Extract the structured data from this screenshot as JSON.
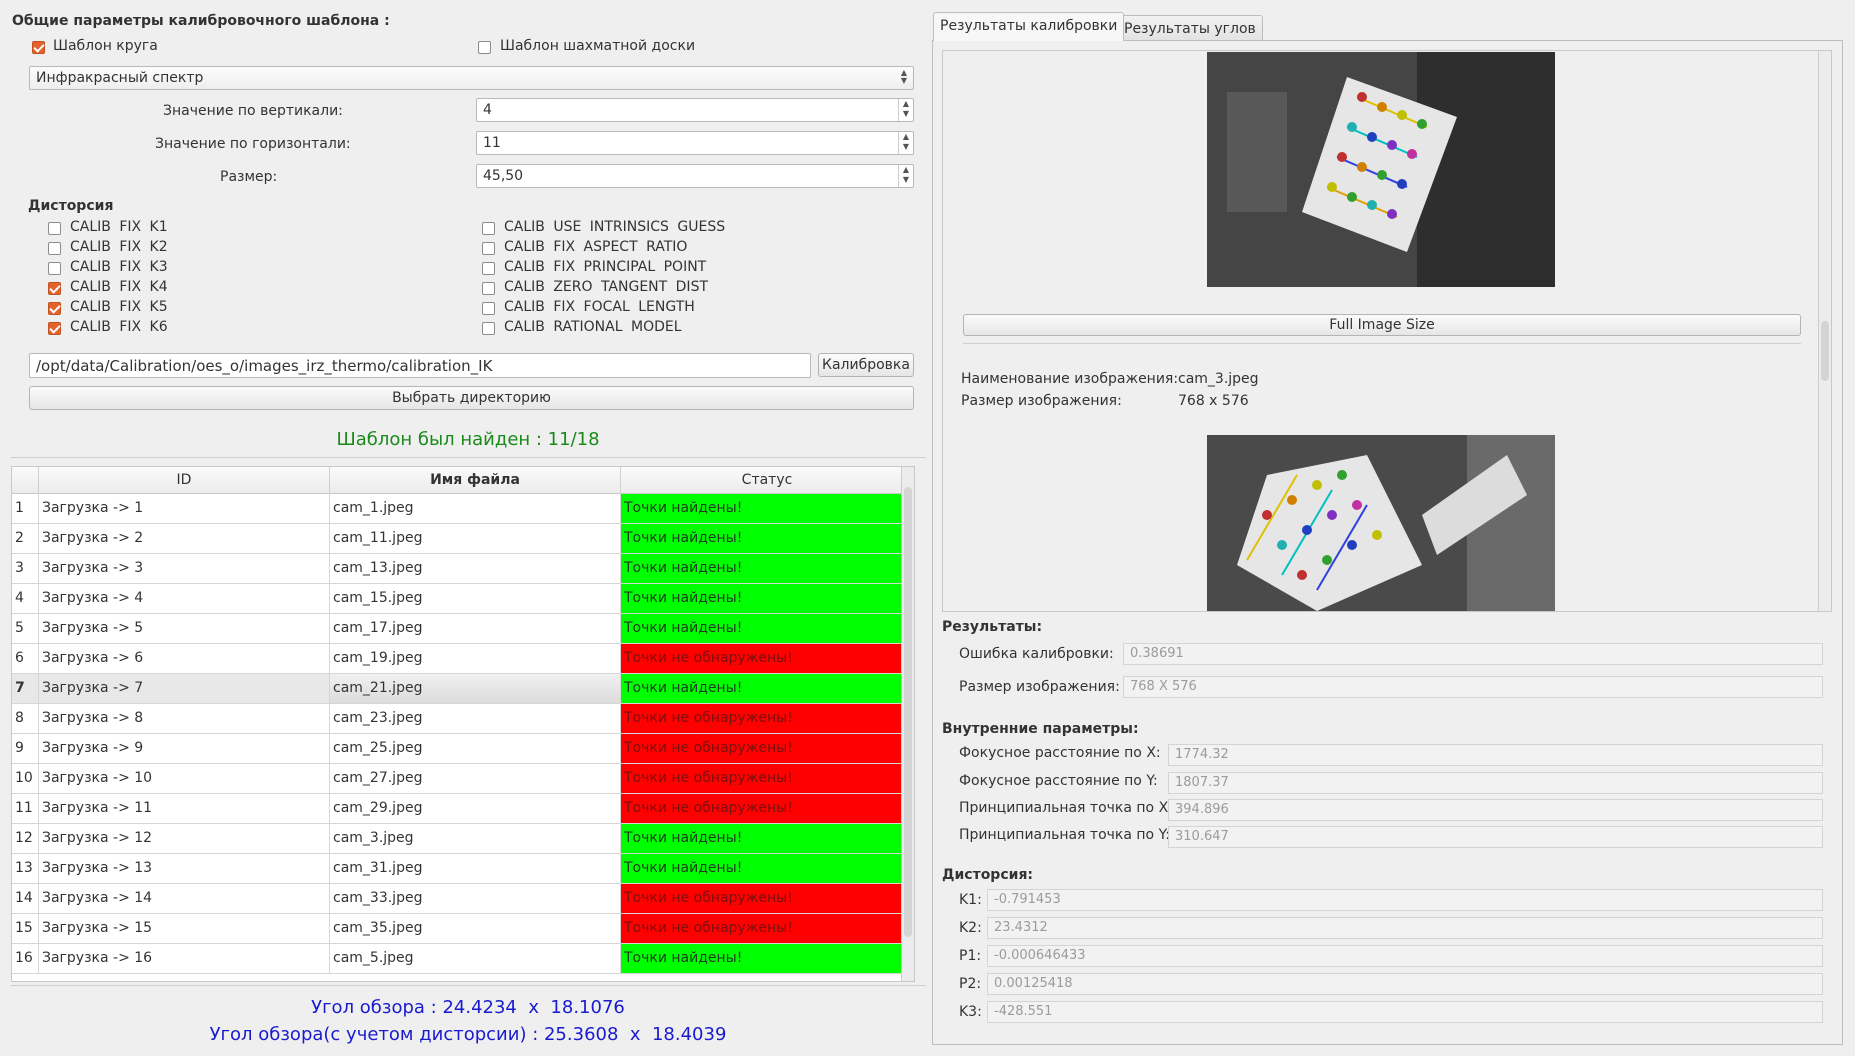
{
  "left": {
    "section_title": "Общие параметры калибровочного шаблона :",
    "circle_template": {
      "label": "Шаблон круга",
      "checked": true
    },
    "chess_template": {
      "label": "Шаблон шахматной доски",
      "checked": false
    },
    "spectrum_select": "Инфракрасный спектр",
    "vertical": {
      "label": "Значение по вертикали:",
      "value": "4"
    },
    "horizontal": {
      "label": "Значение по горизонтали:",
      "value": "11"
    },
    "size": {
      "label": "Размер:",
      "value": "45,50"
    },
    "distortion_title": "Дисторсия",
    "flags_left": [
      {
        "label": "CALIB FIX K1",
        "checked": false
      },
      {
        "label": "CALIB FIX K2",
        "checked": false
      },
      {
        "label": "CALIB FIX K3",
        "checked": false
      },
      {
        "label": "CALIB FIX K4",
        "checked": true
      },
      {
        "label": "CALIB FIX K5",
        "checked": true
      },
      {
        "label": "CALIB FIX K6",
        "checked": true
      }
    ],
    "flags_right": [
      {
        "label": "CALIB USE INTRINSICS GUESS",
        "checked": false
      },
      {
        "label": "CALIB FIX ASPECT RATIO",
        "checked": false
      },
      {
        "label": "CALIB FIX PRINCIPAL POINT",
        "checked": false
      },
      {
        "label": "CALIB ZERO TANGENT DIST",
        "checked": false
      },
      {
        "label": "CALIB FIX FOCAL LENGTH",
        "checked": false
      },
      {
        "label": "CALIB RATIONAL MODEL",
        "checked": false
      }
    ],
    "path_value": "/opt/data/Calibration/oes_o/images_irz_thermo/calibration_IK",
    "calibrate_button": "Калибровка",
    "choose_dir_button": "Выбрать директорию",
    "found_text": "Шаблон был найден : 11/18",
    "table": {
      "headers": [
        "ID",
        "Имя файла",
        "Статус"
      ],
      "rows": [
        {
          "n": "1",
          "id": "Загрузка -> 1",
          "file": "cam_1.jpeg",
          "status": "Точки найдены!",
          "ok": true
        },
        {
          "n": "2",
          "id": "Загрузка -> 2",
          "file": "cam_11.jpeg",
          "status": "Точки найдены!",
          "ok": true
        },
        {
          "n": "3",
          "id": "Загрузка -> 3",
          "file": "cam_13.jpeg",
          "status": "Точки найдены!",
          "ok": true
        },
        {
          "n": "4",
          "id": "Загрузка -> 4",
          "file": "cam_15.jpeg",
          "status": "Точки найдены!",
          "ok": true
        },
        {
          "n": "5",
          "id": "Загрузка -> 5",
          "file": "cam_17.jpeg",
          "status": "Точки найдены!",
          "ok": true
        },
        {
          "n": "6",
          "id": "Загрузка -> 6",
          "file": "cam_19.jpeg",
          "status": "Точки не обнаружены!",
          "ok": false
        },
        {
          "n": "7",
          "id": "Загрузка -> 7",
          "file": "cam_21.jpeg",
          "status": "Точки найдены!",
          "ok": true,
          "selected": true
        },
        {
          "n": "8",
          "id": "Загрузка -> 8",
          "file": "cam_23.jpeg",
          "status": "Точки не обнаружены!",
          "ok": false
        },
        {
          "n": "9",
          "id": "Загрузка -> 9",
          "file": "cam_25.jpeg",
          "status": "Точки не обнаружены!",
          "ok": false
        },
        {
          "n": "10",
          "id": "Загрузка -> 10",
          "file": "cam_27.jpeg",
          "status": "Точки не обнаружены!",
          "ok": false
        },
        {
          "n": "11",
          "id": "Загрузка -> 11",
          "file": "cam_29.jpeg",
          "status": "Точки не обнаружены!",
          "ok": false
        },
        {
          "n": "12",
          "id": "Загрузка -> 12",
          "file": "cam_3.jpeg",
          "status": "Точки найдены!",
          "ok": true
        },
        {
          "n": "13",
          "id": "Загрузка -> 13",
          "file": "cam_31.jpeg",
          "status": "Точки найдены!",
          "ok": true
        },
        {
          "n": "14",
          "id": "Загрузка -> 14",
          "file": "cam_33.jpeg",
          "status": "Точки не обнаружены!",
          "ok": false
        },
        {
          "n": "15",
          "id": "Загрузка -> 15",
          "file": "cam_35.jpeg",
          "status": "Точки не обнаружены!",
          "ok": false
        },
        {
          "n": "16",
          "id": "Загрузка -> 16",
          "file": "cam_5.jpeg",
          "status": "Точки найдены!",
          "ok": true
        }
      ]
    },
    "fov_text": "Угол обзора : 24.4234  x  18.1076",
    "fov_dist_text": "Угол обзора(с учетом дисторсии) : 25.3608  x  18.4039"
  },
  "right": {
    "tabs": [
      "Результаты калибровки",
      "Результаты углов"
    ],
    "full_image_button": "Full Image Size",
    "image_name": {
      "label": "Наименование изображения:",
      "value": "cam_3.jpeg"
    },
    "image_size": {
      "label": "Размер изображения:",
      "value": "768 x 576"
    },
    "results_title": "Результаты:",
    "calib_error": {
      "label": "Ошибка калибровки:",
      "value": "0.38691"
    },
    "result_size": {
      "label": "Размер изображения:",
      "value": "768 X 576"
    },
    "intrinsic_title": "Внутренние параметры:",
    "fx": {
      "label": "Фокусное расстояние по X:",
      "value": "1774.32"
    },
    "fy": {
      "label": "Фокусное расстояние по Y:",
      "value": "1807.37"
    },
    "px": {
      "label": "Принципиальная точка по X:",
      "value": "394.896"
    },
    "py": {
      "label": "Принципиальная точка по Y:",
      "value": "310.647"
    },
    "distortion_title": "Дисторсия:",
    "k1": {
      "label": "K1:",
      "value": "-0.791453"
    },
    "k2": {
      "label": "K2:",
      "value": "23.4312"
    },
    "p1": {
      "label": "P1:",
      "value": "-0.000646433"
    },
    "p2": {
      "label": "P2:",
      "value": "0.00125418"
    },
    "k3": {
      "label": "K3:",
      "value": "-428.551"
    }
  },
  "colors": {
    "ok": "#00ff00",
    "bad": "#ff0000",
    "found_text": "#1a8a1a",
    "fov_text": "#1a1ad0",
    "accent": "#e2632c"
  }
}
